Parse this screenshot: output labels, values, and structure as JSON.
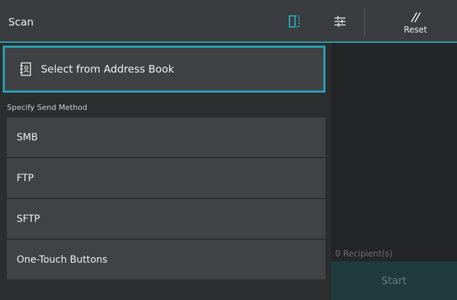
{
  "header": {
    "title": "Scan",
    "reset_label": "Reset",
    "icons": {
      "preview": "page-preview-icon",
      "settings": "settings-sliders-icon",
      "reset": "reset-icon"
    },
    "accent": "#2aa3b7"
  },
  "address_book": {
    "label": "Select from Address Book",
    "icon": "address-book-icon"
  },
  "send_method": {
    "section_label": "Specify Send Method",
    "items": [
      {
        "label": "SMB"
      },
      {
        "label": "FTP"
      },
      {
        "label": "SFTP"
      },
      {
        "label": "One-Touch Buttons"
      }
    ]
  },
  "recipients": {
    "count_text": "0 Recipient(s)"
  },
  "start": {
    "label": "Start"
  }
}
